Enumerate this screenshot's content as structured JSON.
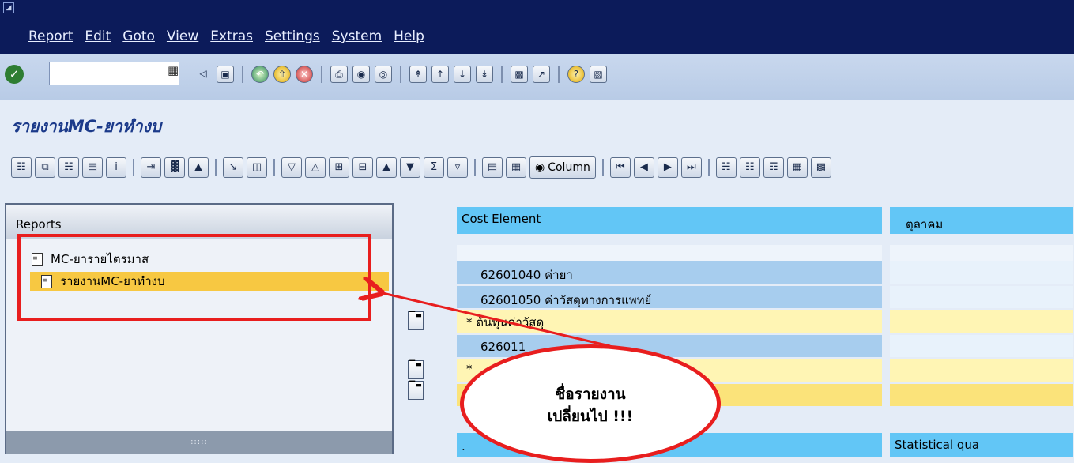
{
  "window": {
    "system_icon": "window-menu-icon"
  },
  "menu": [
    "Report",
    "Edit",
    "Goto",
    "View",
    "Extras",
    "Settings",
    "System",
    "Help"
  ],
  "toolbar": {
    "command_value": ""
  },
  "page": {
    "title": "รายงานMC-ยาทำงบ"
  },
  "app_toolbar": {
    "column_label": "Column"
  },
  "left_panel": {
    "header": "Reports",
    "items": [
      {
        "label": "MC-ยารายไตรมาส",
        "selected": false
      },
      {
        "label": "รายงานMC-ยาทำงบ",
        "selected": true
      }
    ],
    "sash_dots": ":::::"
  },
  "grid": {
    "col1_header": "Cost Element",
    "col2_header": "ตุลาคม",
    "rows": [
      {
        "text": "62601040  ค่ายา"
      },
      {
        "text": "62601050  ค่าวัสดุทางการแพทย์"
      },
      {
        "text": "*  ต้นทุนค่าวัสดุ"
      },
      {
        "text": "626011"
      },
      {
        "text": "*"
      }
    ],
    "footer_col1": ".",
    "footer_col2": "Statistical qua"
  },
  "callout": {
    "line1": "ชื่อรายงาน",
    "line2": "เปลี่ยนไป !!!"
  },
  "colors": {
    "title_bar": "#0c1b5a",
    "selected_row": "#f7c842",
    "annotation_red": "#e81e1e",
    "grid_header": "#62c6f6"
  }
}
